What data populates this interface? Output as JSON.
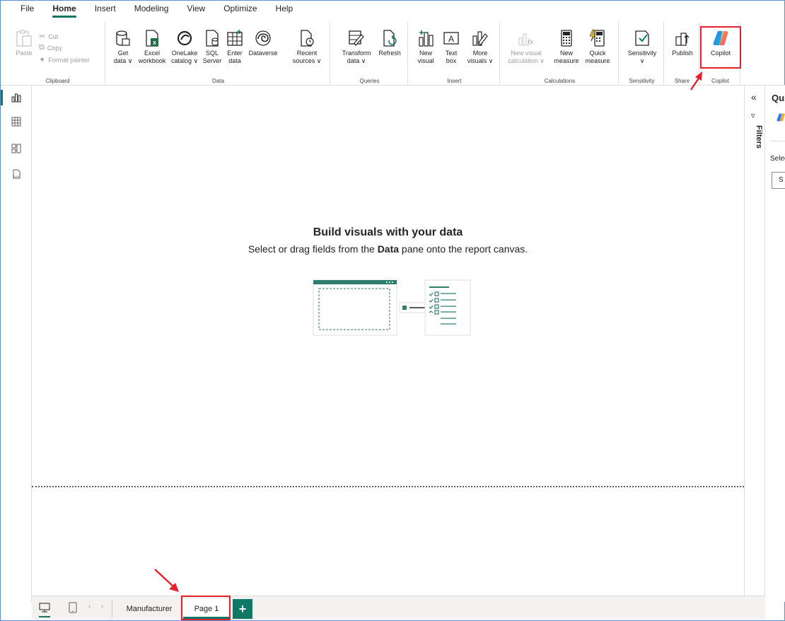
{
  "menu": {
    "tabs": [
      "File",
      "Home",
      "Insert",
      "Modeling",
      "View",
      "Optimize",
      "Help"
    ],
    "active": "Home"
  },
  "ribbon": {
    "clipboard": {
      "label": "Clipboard",
      "paste": "Paste",
      "cut": "Cut",
      "copy": "Copy",
      "format_painter": "Format painter"
    },
    "data": {
      "label": "Data",
      "get_data_1": "Get",
      "get_data_2": "data ∨",
      "excel_1": "Excel",
      "excel_2": "workbook",
      "onelake_1": "OneLake",
      "onelake_2": "catalog ∨",
      "sql_1": "SQL",
      "sql_2": "Server",
      "enter_1": "Enter",
      "enter_2": "data",
      "dataverse_1": "Dataverse",
      "recent_1": "Recent",
      "recent_2": "sources ∨"
    },
    "queries": {
      "label": "Queries",
      "transform_1": "Transform",
      "transform_2": "data ∨",
      "refresh_1": "Refresh"
    },
    "insert": {
      "label": "Insert",
      "new_visual_1": "New",
      "new_visual_2": "visual",
      "text_box_1": "Text",
      "text_box_2": "box",
      "more_visuals_1": "More",
      "more_visuals_2": "visuals ∨"
    },
    "calculations": {
      "label": "Calculations",
      "new_visual_calc_1": "New visual",
      "new_visual_calc_2": "calculation ∨",
      "new_measure_1": "New",
      "new_measure_2": "measure",
      "quick_measure_1": "Quick",
      "quick_measure_2": "measure"
    },
    "sensitivity": {
      "label": "Sensitivity",
      "button_1": "Sensitivity",
      "button_2": "∨"
    },
    "share": {
      "label": "Share",
      "publish": "Publish"
    },
    "copilot": {
      "label": "Copilot",
      "button": "Copilot"
    }
  },
  "canvas": {
    "title": "Build visuals with your data",
    "subtitle_pre": "Select or drag fields from the ",
    "subtitle_bold": "Data",
    "subtitle_post": " pane onto the report canvas."
  },
  "right": {
    "collapse_glyph": "«",
    "filters": "Filters",
    "pane_title_partial": "Qui",
    "select_partial": "Selec",
    "input_partial": "S"
  },
  "pages": {
    "tabs": [
      "Manufacturer",
      "Page 1"
    ],
    "active": "Page 1",
    "add": "+"
  },
  "colors": {
    "accent": "#117865",
    "annotation": "#e3202c"
  }
}
